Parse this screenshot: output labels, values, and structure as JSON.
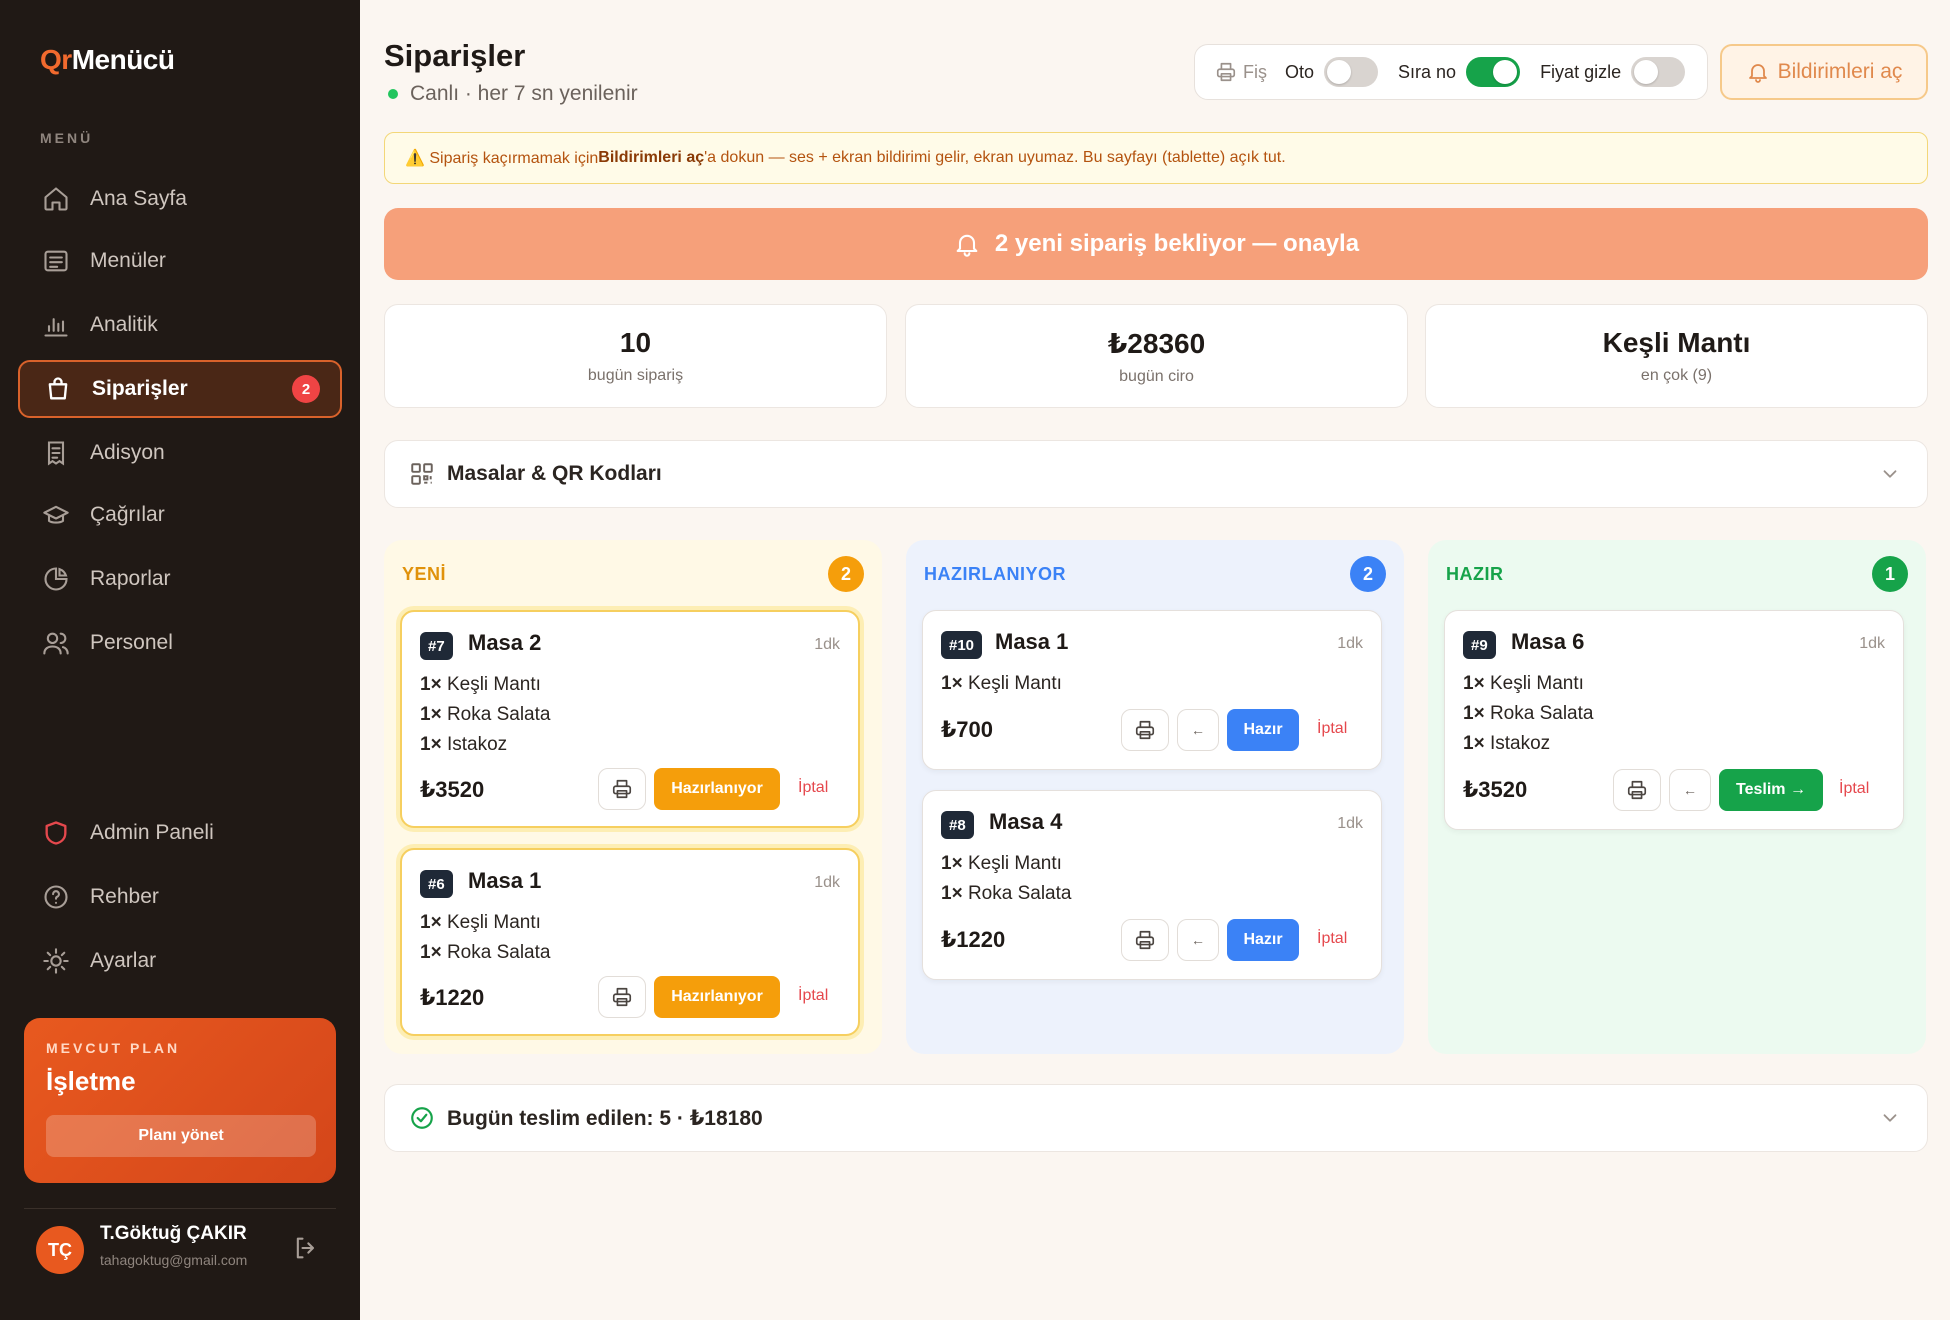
{
  "app": {
    "logo_prefix": "Qr",
    "logo_suffix": "Menücü"
  },
  "sidebar": {
    "menu_header": "MENÜ",
    "items": [
      {
        "label": "Ana Sayfa",
        "icon": "home-icon"
      },
      {
        "label": "Menüler",
        "icon": "menu-list-icon"
      },
      {
        "label": "Analitik",
        "icon": "bar-chart-icon"
      },
      {
        "label": "Siparişler",
        "icon": "shopping-bag-icon",
        "badge": "2",
        "active": true
      },
      {
        "label": "Adisyon",
        "icon": "receipt-icon"
      },
      {
        "label": "Çağrılar",
        "icon": "graduation-cap-icon"
      },
      {
        "label": "Raporlar",
        "icon": "pie-chart-icon"
      },
      {
        "label": "Personel",
        "icon": "users-icon"
      }
    ],
    "bottom_items": [
      {
        "label": "Admin Paneli",
        "icon": "shield-icon"
      },
      {
        "label": "Rehber",
        "icon": "help-circle-icon"
      },
      {
        "label": "Ayarlar",
        "icon": "sun-icon"
      }
    ],
    "plan": {
      "label": "MEVCUT PLAN",
      "name": "İşletme",
      "button": "Planı yönet"
    },
    "user": {
      "initials": "TÇ",
      "name": "T.Göktuğ ÇAKIR",
      "email": "tahagoktug@gmail.com"
    }
  },
  "header": {
    "title": "Siparişler",
    "live_text": "Canlı · her 7 sn yenilenir",
    "toolbar": {
      "fis": "Fiş",
      "oto": "Oto",
      "oto_on": false,
      "sira_no": "Sıra no",
      "sira_no_on": true,
      "fiyat_gizle": "Fiyat gizle",
      "fiyat_gizle_on": false
    },
    "notify_button": "Bildirimleri aç"
  },
  "warning": {
    "prefix": "⚠️ Sipariş kaçırmamak için ",
    "bold": "Bildirimleri aç",
    "suffix": "'a dokun — ses + ekran bildirimi gelir, ekran uyumaz. Bu sayfayı (tablette) açık tut."
  },
  "pending_banner": "2 yeni sipariş bekliyor — onayla",
  "stats": [
    {
      "value": "10",
      "label": "bugün sipariş"
    },
    {
      "value": "₺28360",
      "label": "bugün ciro"
    },
    {
      "value": "Keşli Mantı",
      "label": "en çok (9)"
    }
  ],
  "tables_section": "Masalar & QR Kodları",
  "columns": {
    "yeni": {
      "title": "YENİ",
      "count": "2",
      "color": "#f59e0b",
      "orders": [
        {
          "no": "#7",
          "table": "Masa 2",
          "elapsed": "1dk",
          "items": [
            [
              "1×",
              "Keşli Mantı"
            ],
            [
              "1×",
              "Roka Salata"
            ],
            [
              "1×",
              "Istakoz"
            ]
          ],
          "price": "₺3520",
          "action": "Hazırlanıyor",
          "cancel": "İptal"
        },
        {
          "no": "#6",
          "table": "Masa 1",
          "elapsed": "1dk",
          "items": [
            [
              "1×",
              "Keşli Mantı"
            ],
            [
              "1×",
              "Roka Salata"
            ]
          ],
          "price": "₺1220",
          "action": "Hazırlanıyor",
          "cancel": "İptal"
        }
      ]
    },
    "hazirlaniyor": {
      "title": "HAZIRLANIYOR",
      "count": "2",
      "color": "#3b82f6",
      "orders": [
        {
          "no": "#10",
          "table": "Masa 1",
          "elapsed": "1dk",
          "items": [
            [
              "1×",
              "Keşli Mantı"
            ]
          ],
          "price": "₺700",
          "back": "←",
          "action": "Hazır",
          "cancel": "İptal"
        },
        {
          "no": "#8",
          "table": "Masa 4",
          "elapsed": "1dk",
          "items": [
            [
              "1×",
              "Keşli Mantı"
            ],
            [
              "1×",
              "Roka Salata"
            ]
          ],
          "price": "₺1220",
          "back": "←",
          "action": "Hazır",
          "cancel": "İptal"
        }
      ]
    },
    "hazir": {
      "title": "HAZIR",
      "count": "1",
      "color": "#16a34a",
      "orders": [
        {
          "no": "#9",
          "table": "Masa 6",
          "elapsed": "1dk",
          "items": [
            [
              "1×",
              "Keşli Mantı"
            ],
            [
              "1×",
              "Roka Salata"
            ],
            [
              "1×",
              "Istakoz"
            ]
          ],
          "price": "₺3520",
          "back": "←",
          "action": "Teslim →",
          "cancel": "İptal"
        }
      ]
    }
  },
  "delivered_section": "Bugün teslim edilen: 5 · ₺18180"
}
